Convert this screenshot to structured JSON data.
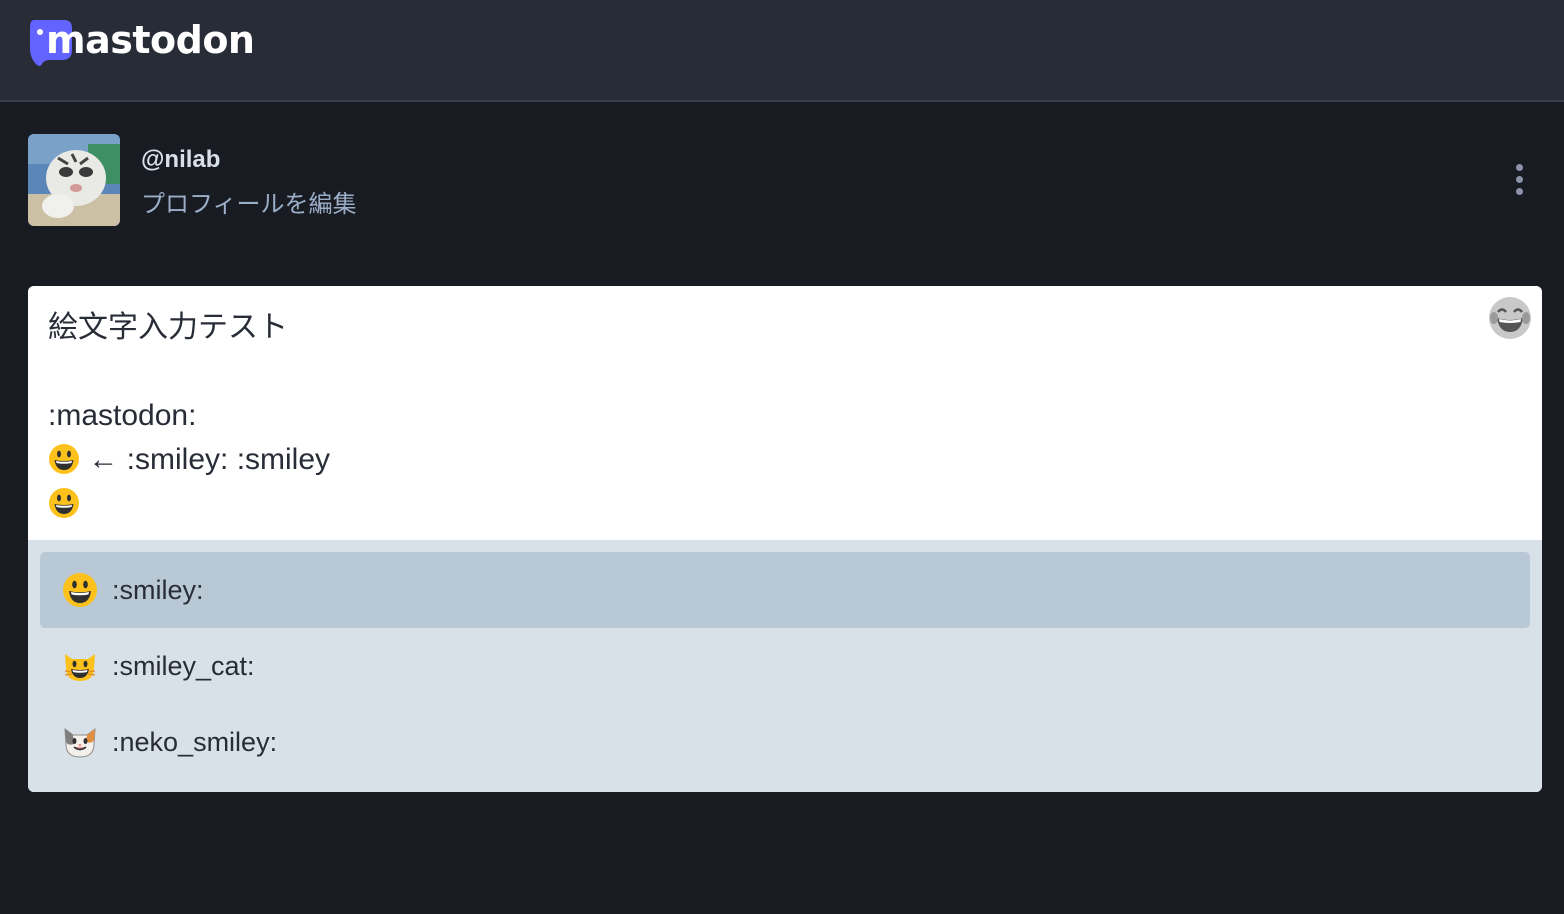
{
  "header": {
    "logo_text": "mastodon",
    "brand_color": "#6364ff",
    "background": "#282c37"
  },
  "profile": {
    "handle": "@nilab",
    "edit_label": "プロフィールを編集",
    "menu_icon": "vertical-ellipsis-icon"
  },
  "compose": {
    "lines": [
      "絵文字入力テスト",
      "",
      ":mastodon:",
      "← :smiley: :smiley",
      ""
    ],
    "emoji_button_icon": "laughing-tears-emoji-icon"
  },
  "suggestions": {
    "items": [
      {
        "label": ":smiley:",
        "icon": "smiley-emoji",
        "selected": true
      },
      {
        "label": ":smiley_cat:",
        "icon": "smiley-cat-emoji",
        "selected": false
      },
      {
        "label": ":neko_smiley:",
        "icon": "neko-smiley-emoji",
        "selected": false
      }
    ]
  },
  "colors": {
    "page_bg": "#191b22",
    "suggestion_bg": "#d9e1e8",
    "suggestion_selected_bg": "#b9c8d5"
  }
}
